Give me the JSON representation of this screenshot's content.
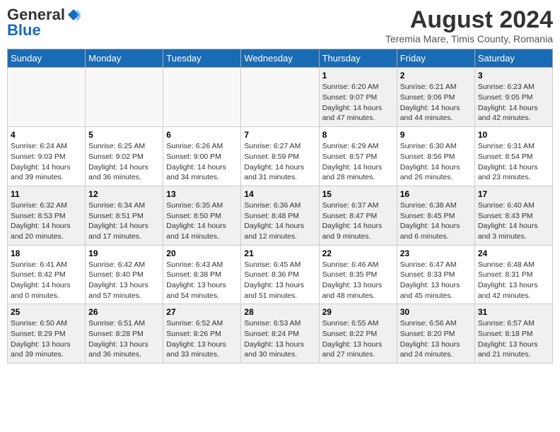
{
  "logo": {
    "general": "General",
    "blue": "Blue"
  },
  "title": "August 2024",
  "subtitle": "Teremia Mare, Timis County, Romania",
  "days_of_week": [
    "Sunday",
    "Monday",
    "Tuesday",
    "Wednesday",
    "Thursday",
    "Friday",
    "Saturday"
  ],
  "weeks": [
    [
      {
        "day": "",
        "info": ""
      },
      {
        "day": "",
        "info": ""
      },
      {
        "day": "",
        "info": ""
      },
      {
        "day": "",
        "info": ""
      },
      {
        "day": "1",
        "info": "Sunrise: 6:20 AM\nSunset: 9:07 PM\nDaylight: 14 hours and 47 minutes."
      },
      {
        "day": "2",
        "info": "Sunrise: 6:21 AM\nSunset: 9:06 PM\nDaylight: 14 hours and 44 minutes."
      },
      {
        "day": "3",
        "info": "Sunrise: 6:23 AM\nSunset: 9:05 PM\nDaylight: 14 hours and 42 minutes."
      }
    ],
    [
      {
        "day": "4",
        "info": "Sunrise: 6:24 AM\nSunset: 9:03 PM\nDaylight: 14 hours and 39 minutes."
      },
      {
        "day": "5",
        "info": "Sunrise: 6:25 AM\nSunset: 9:02 PM\nDaylight: 14 hours and 36 minutes."
      },
      {
        "day": "6",
        "info": "Sunrise: 6:26 AM\nSunset: 9:00 PM\nDaylight: 14 hours and 34 minutes."
      },
      {
        "day": "7",
        "info": "Sunrise: 6:27 AM\nSunset: 8:59 PM\nDaylight: 14 hours and 31 minutes."
      },
      {
        "day": "8",
        "info": "Sunrise: 6:29 AM\nSunset: 8:57 PM\nDaylight: 14 hours and 28 minutes."
      },
      {
        "day": "9",
        "info": "Sunrise: 6:30 AM\nSunset: 8:56 PM\nDaylight: 14 hours and 26 minutes."
      },
      {
        "day": "10",
        "info": "Sunrise: 6:31 AM\nSunset: 8:54 PM\nDaylight: 14 hours and 23 minutes."
      }
    ],
    [
      {
        "day": "11",
        "info": "Sunrise: 6:32 AM\nSunset: 8:53 PM\nDaylight: 14 hours and 20 minutes."
      },
      {
        "day": "12",
        "info": "Sunrise: 6:34 AM\nSunset: 8:51 PM\nDaylight: 14 hours and 17 minutes."
      },
      {
        "day": "13",
        "info": "Sunrise: 6:35 AM\nSunset: 8:50 PM\nDaylight: 14 hours and 14 minutes."
      },
      {
        "day": "14",
        "info": "Sunrise: 6:36 AM\nSunset: 8:48 PM\nDaylight: 14 hours and 12 minutes."
      },
      {
        "day": "15",
        "info": "Sunrise: 6:37 AM\nSunset: 8:47 PM\nDaylight: 14 hours and 9 minutes."
      },
      {
        "day": "16",
        "info": "Sunrise: 6:38 AM\nSunset: 8:45 PM\nDaylight: 14 hours and 6 minutes."
      },
      {
        "day": "17",
        "info": "Sunrise: 6:40 AM\nSunset: 8:43 PM\nDaylight: 14 hours and 3 minutes."
      }
    ],
    [
      {
        "day": "18",
        "info": "Sunrise: 6:41 AM\nSunset: 8:42 PM\nDaylight: 14 hours and 0 minutes."
      },
      {
        "day": "19",
        "info": "Sunrise: 6:42 AM\nSunset: 8:40 PM\nDaylight: 13 hours and 57 minutes."
      },
      {
        "day": "20",
        "info": "Sunrise: 6:43 AM\nSunset: 8:38 PM\nDaylight: 13 hours and 54 minutes."
      },
      {
        "day": "21",
        "info": "Sunrise: 6:45 AM\nSunset: 8:36 PM\nDaylight: 13 hours and 51 minutes."
      },
      {
        "day": "22",
        "info": "Sunrise: 6:46 AM\nSunset: 8:35 PM\nDaylight: 13 hours and 48 minutes."
      },
      {
        "day": "23",
        "info": "Sunrise: 6:47 AM\nSunset: 8:33 PM\nDaylight: 13 hours and 45 minutes."
      },
      {
        "day": "24",
        "info": "Sunrise: 6:48 AM\nSunset: 8:31 PM\nDaylight: 13 hours and 42 minutes."
      }
    ],
    [
      {
        "day": "25",
        "info": "Sunrise: 6:50 AM\nSunset: 8:29 PM\nDaylight: 13 hours and 39 minutes."
      },
      {
        "day": "26",
        "info": "Sunrise: 6:51 AM\nSunset: 8:28 PM\nDaylight: 13 hours and 36 minutes."
      },
      {
        "day": "27",
        "info": "Sunrise: 6:52 AM\nSunset: 8:26 PM\nDaylight: 13 hours and 33 minutes."
      },
      {
        "day": "28",
        "info": "Sunrise: 6:53 AM\nSunset: 8:24 PM\nDaylight: 13 hours and 30 minutes."
      },
      {
        "day": "29",
        "info": "Sunrise: 6:55 AM\nSunset: 8:22 PM\nDaylight: 13 hours and 27 minutes."
      },
      {
        "day": "30",
        "info": "Sunrise: 6:56 AM\nSunset: 8:20 PM\nDaylight: 13 hours and 24 minutes."
      },
      {
        "day": "31",
        "info": "Sunrise: 6:57 AM\nSunset: 8:18 PM\nDaylight: 13 hours and 21 minutes."
      }
    ]
  ]
}
